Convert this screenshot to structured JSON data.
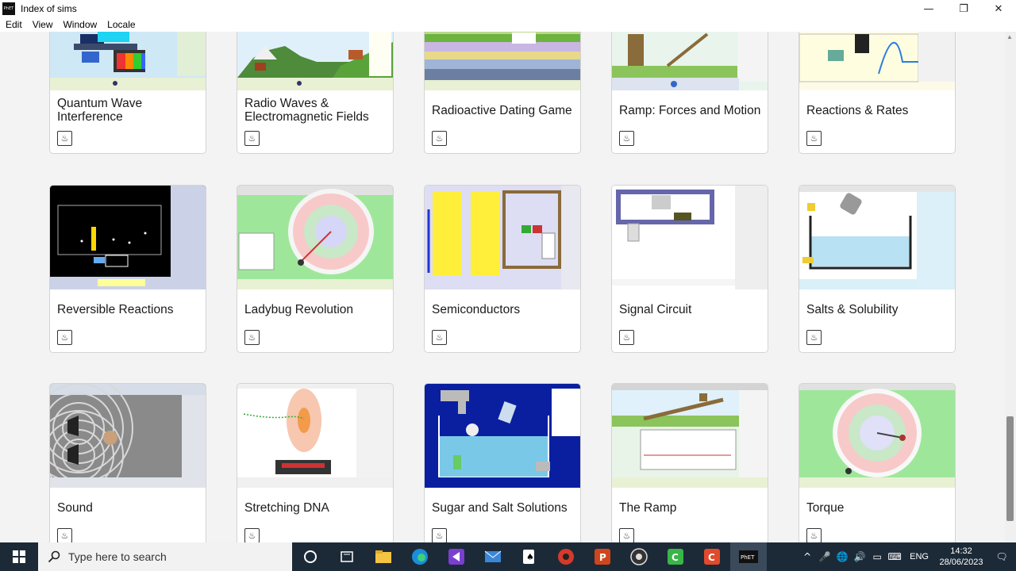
{
  "window": {
    "title": "Index of sims",
    "app_icon_text": "PhET"
  },
  "controls": {
    "minimize": "—",
    "maximize": "❐",
    "close": "✕"
  },
  "menu": [
    "Edit",
    "View",
    "Window",
    "Locale"
  ],
  "cards": [
    {
      "title": "Quantum Wave Interference",
      "thumb": "quantum",
      "icon": "java-icon"
    },
    {
      "title": "Radio Waves & Electromagnetic Fields",
      "thumb": "radio",
      "icon": "java-icon"
    },
    {
      "title": "Radioactive Dating Game",
      "thumb": "dating",
      "icon": "java-icon"
    },
    {
      "title": "Ramp: Forces and Motion",
      "thumb": "ramp-forces",
      "icon": "java-icon"
    },
    {
      "title": "Reactions & Rates",
      "thumb": "reactions",
      "icon": "java-icon"
    },
    {
      "title": "Reversible Reactions",
      "thumb": "reversible",
      "icon": "java-icon"
    },
    {
      "title": "Ladybug Revolution",
      "thumb": "ladybug",
      "icon": "java-icon"
    },
    {
      "title": "Semiconductors",
      "thumb": "semi",
      "icon": "java-icon"
    },
    {
      "title": "Signal Circuit",
      "thumb": "signal",
      "icon": "java-icon"
    },
    {
      "title": "Salts & Solubility",
      "thumb": "salts",
      "icon": "java-icon"
    },
    {
      "title": "Sound",
      "thumb": "sound",
      "icon": "java-icon"
    },
    {
      "title": "Stretching DNA",
      "thumb": "dna",
      "icon": "java-icon"
    },
    {
      "title": "Sugar and Salt Solutions",
      "thumb": "sugar",
      "icon": "java-icon"
    },
    {
      "title": "The Ramp",
      "thumb": "the-ramp",
      "icon": "java-icon"
    },
    {
      "title": "Torque",
      "thumb": "torque",
      "icon": "java-icon"
    }
  ],
  "taskbar": {
    "search_placeholder": "Type here to search",
    "language": "ENG",
    "time": "14:32",
    "date": "28/06/2023",
    "apps": [
      "cortana-icon",
      "task-view-icon",
      "file-explorer-icon",
      "edge-icon",
      "visual-studio-icon",
      "mail-icon",
      "solitaire-icon",
      "game-icon",
      "powerpoint-icon",
      "obs-icon",
      "camtasia-green-icon",
      "camtasia-red-icon",
      "phet-icon"
    ]
  }
}
